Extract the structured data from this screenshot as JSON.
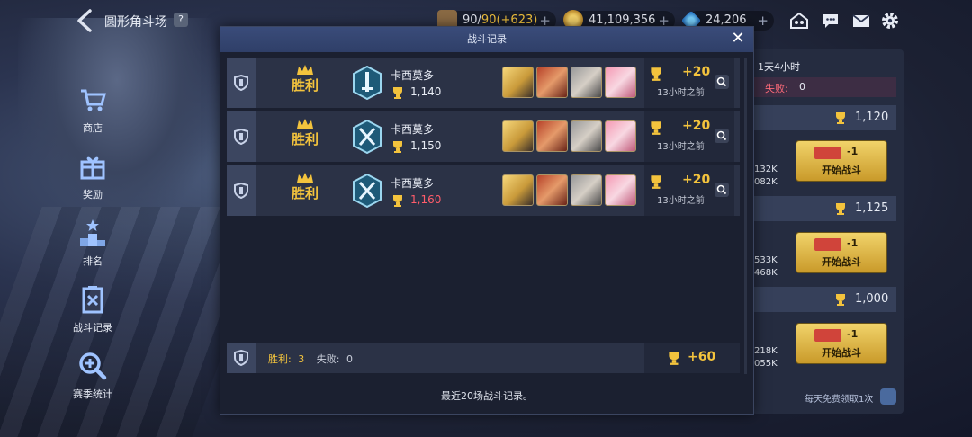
{
  "screen": {
    "title": "圆形角斗场",
    "help": "?"
  },
  "resources": {
    "stamina": {
      "value": "90/",
      "max": "90",
      "bonus": "(+623)",
      "plus": "+",
      "icon": "coffee-cup-icon"
    },
    "gold": {
      "value": "41,109,356",
      "plus": "+",
      "icon": "gold-coin-icon"
    },
    "gems": {
      "value": "24,206",
      "plus": "+",
      "icon": "blue-gem-icon"
    }
  },
  "top_icons": [
    "guild-icon",
    "chat-icon",
    "mail-icon",
    "settings-gear-icon"
  ],
  "sidebar": {
    "items": [
      {
        "label": "商店",
        "icon": "cart-icon"
      },
      {
        "label": "奖励",
        "icon": "gift-icon"
      },
      {
        "label": "排名",
        "icon": "podium-icon"
      },
      {
        "label": "战斗记录",
        "icon": "clipboard-x-icon"
      },
      {
        "label": "赛季统计",
        "icon": "magnifier-plus-icon"
      }
    ]
  },
  "modal": {
    "title": "战斗记录",
    "close": "✕",
    "records": [
      {
        "result": "胜利",
        "opponent": "卡西莫多",
        "trophies": "1,140",
        "trophies_red": false,
        "gain": "+20",
        "time": "13小时之前"
      },
      {
        "result": "胜利",
        "opponent": "卡西莫多",
        "trophies": "1,150",
        "trophies_red": false,
        "gain": "+20",
        "time": "13小时之前"
      },
      {
        "result": "胜利",
        "opponent": "卡西莫多",
        "trophies": "1,160",
        "trophies_red": true,
        "gain": "+20",
        "time": "13小时之前"
      }
    ],
    "summary": {
      "wins_label": "胜利:",
      "wins": "3",
      "losses_label": "失败:",
      "losses": "0",
      "total_gain": "+60"
    },
    "footer": "最近20场战斗记录。"
  },
  "right_panel": {
    "timer": "1天4小时",
    "loss_label": "失败:",
    "loss_value": "0",
    "opponents": [
      {
        "score": "1,120",
        "power_a": "132K",
        "power_b": "082K",
        "cost": "-1",
        "button": "开始战斗"
      },
      {
        "score": "1,125",
        "power_a": "533K",
        "power_b": "468K",
        "cost": "-1",
        "button": "开始战斗"
      },
      {
        "score": "1,000",
        "power_a": "218K",
        "power_b": "055K",
        "cost": "-1",
        "button": "开始战斗"
      }
    ],
    "free_note": "每天免费领取1次"
  },
  "colors": {
    "accent_gold": "#f3c33d",
    "loss_red": "#ff5c6a",
    "header_blue": "#33446f"
  }
}
